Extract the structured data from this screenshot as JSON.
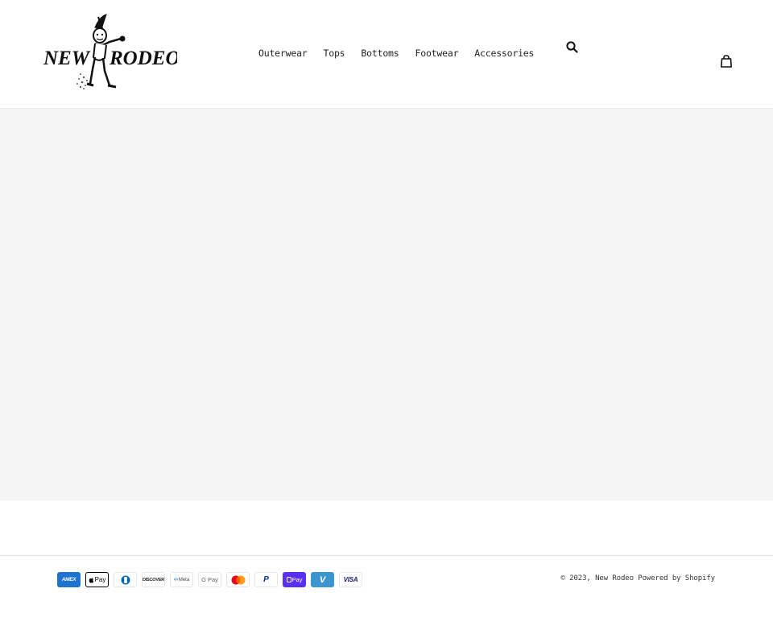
{
  "header": {
    "logo_alt": "New Rodeo",
    "logo_text_left": "NEW",
    "logo_text_right": "RODEO",
    "nav": [
      {
        "label": "Outerwear"
      },
      {
        "label": "Tops"
      },
      {
        "label": "Bottoms"
      },
      {
        "label": "Footwear"
      },
      {
        "label": "Accessories"
      }
    ],
    "search_icon": "search-icon",
    "cart_icon": "shopping-bag-icon"
  },
  "footer": {
    "payment_methods": [
      {
        "name": "American Express",
        "label": "AMEX"
      },
      {
        "name": "Apple Pay",
        "label": "Pay"
      },
      {
        "name": "Diners Club",
        "label": ""
      },
      {
        "name": "Discover",
        "label": "DISCOVER"
      },
      {
        "name": "Meta Pay",
        "label": "Meta"
      },
      {
        "name": "Google Pay",
        "label": "G Pay"
      },
      {
        "name": "Mastercard",
        "label": ""
      },
      {
        "name": "PayPal",
        "label": "P"
      },
      {
        "name": "Shop Pay",
        "label": "Pay"
      },
      {
        "name": "Venmo",
        "label": "V"
      },
      {
        "name": "Visa",
        "label": "VISA"
      }
    ],
    "copyright_prefix": "© 2023,",
    "store_name": "New Rodeo",
    "powered_by": "Powered by Shopify"
  },
  "colors": {
    "amex": "#1f72cd",
    "shop_pay": "#5a31f4",
    "venmo": "#3d95ce",
    "visa": "#1a1f71",
    "main_bg": "#f5f5f5"
  }
}
